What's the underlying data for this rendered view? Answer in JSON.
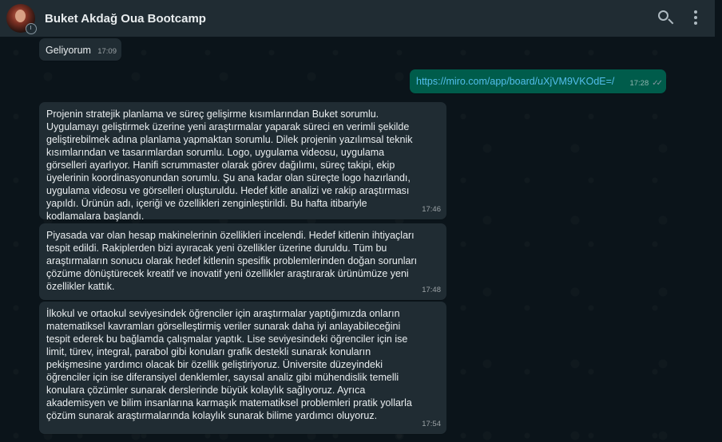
{
  "header": {
    "title": "Buket Akdağ Oua Bootcamp",
    "icons": [
      "search-icon",
      "menu-icon"
    ]
  },
  "messages": [
    {
      "direction": "in",
      "text": "Geliyorum",
      "time": "17:09"
    },
    {
      "direction": "out",
      "text": "https://miro.com/app/board/uXjVM9VKOdE=/",
      "time": "17:28",
      "status": "read"
    },
    {
      "direction": "in",
      "text": "Projenin stratejik planlama ve süreç gelişirme kısımlarından Buket sorumlu. Uygulamayı geliştirmek üzerine yeni araştırmalar yaparak süreci en verimli şekilde geliştirebilmek adına planlama yapmaktan sorumlu. Dilek projenin yazılımsal teknik kısımlarından ve tasarımlardan sorumlu. Logo, uygulama videosu, uygulama görselleri ayarlıyor. Hanifi scrummaster olarak görev dağılımı, süreç takipi, ekip üyelerinin koordinasyonundan sorumlu. Şu ana kadar olan süreçte logo hazırlandı, uygulama videosu ve görselleri oluşturuldu. Hedef kitle analizi ve rakip araştırması yapıldı. Ürünün adı, içeriği ve özellikleri zenginleştirildi.  Bu hafta itibariyle kodlamalara başlandı.",
      "time": "17:46"
    },
    {
      "direction": "in",
      "text": "Piyasada var olan hesap makinelerinin özellikleri incelendi. Hedef kitlenin ihtiyaçları tespit edildi. Rakiplerden bizi ayıracak yeni özellikler üzerine duruldu. Tüm bu araştırmaların sonucu olarak hedef kitlenin spesifik problemlerinden doğan sorunları çözüme dönüştürecek kreatif ve inovatif yeni özellikler araştırarak ürünümüze yeni özellikler kattık.",
      "time": "17:48"
    },
    {
      "direction": "in",
      "text": "İlkokul ve ortaokul seviyesindek öğrenciler için araştırmalar yaptığımızda onların matematiksel kavramları görselleştirmiş veriler sunarak daha iyi anlayabileceğini tespit ederek bu bağlamda çalışmalar yaptık. Lise seviyesindeki öğrenciler için ise limit, türev, integral, parabol gibi konuları grafik destekli sunarak konuların pekişmesine yardımcı olacak bir özellik geliştiriyoruz. Üniversite düzeyindeki öğrenciler için ise diferansiyel denklemler, sayısal analiz gibi mühendislik temelli konulara çözümler sunarak derslerinde büyük kolaylık sağlıyoruz. Ayrıca akademisyen ve bilim insanlarına karmaşık matematiksel problemleri pratik yollarla çözüm sunarak araştırmalarında kolaylık sunarak bilime yardımcı oluyoruz.",
      "time": "17:54"
    }
  ],
  "colors": {
    "background": "#0b141a",
    "header": "#202c33",
    "incoming_bubble": "#202c33",
    "outgoing_bubble": "#005c4b",
    "link": "#53bdeb"
  }
}
